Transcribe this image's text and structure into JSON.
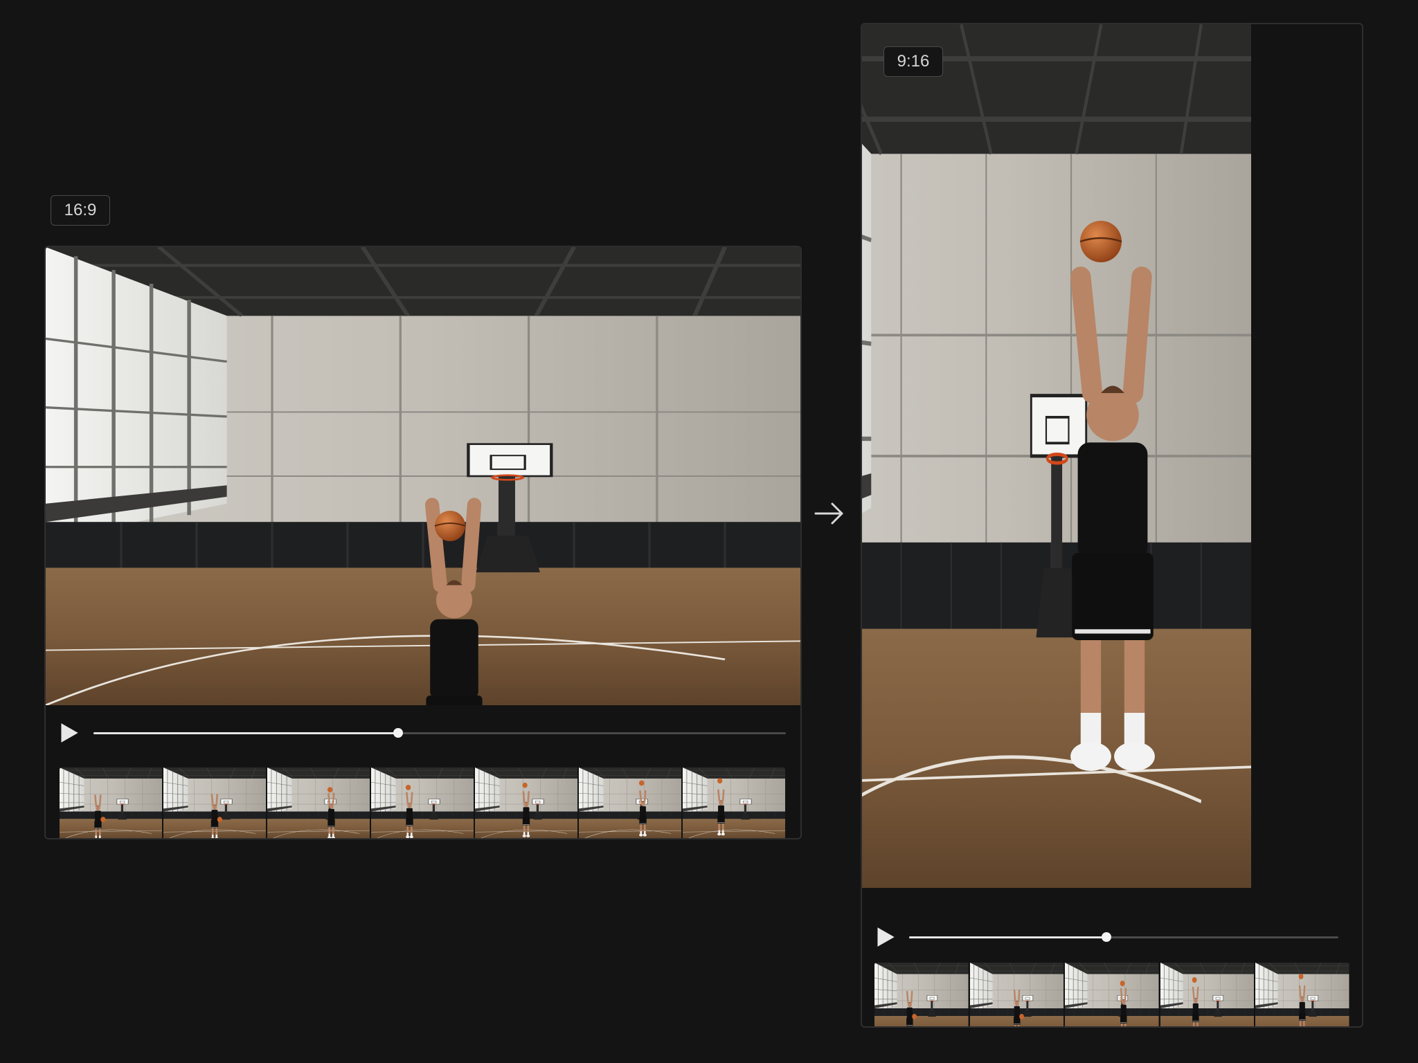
{
  "left": {
    "ratio_label": "16:9",
    "progress": 0.44,
    "thumbnails": [
      "dribble",
      "stance",
      "set",
      "gather",
      "rise",
      "release",
      "follow-through"
    ]
  },
  "right": {
    "ratio_label": "9:16",
    "progress": 0.46,
    "thumbnails": [
      "dribble",
      "set",
      "gather",
      "rise",
      "release"
    ]
  },
  "icons": {
    "play": "play-icon",
    "arrow": "arrow-right-icon"
  },
  "colors": {
    "background": "#141414",
    "progress_fill": "#e6e6e6",
    "progress_track": "#4a4a4a",
    "ball": "#c7652a"
  }
}
